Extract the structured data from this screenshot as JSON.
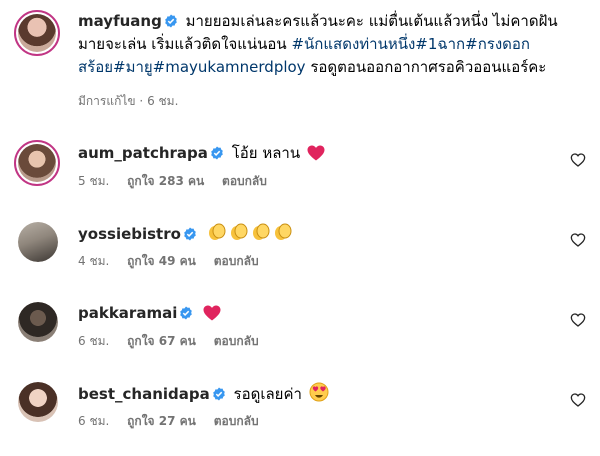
{
  "caption": {
    "username": "mayfuang",
    "text": "มายยอมเล่นละครแล้วนะคะ แม่ตื่นเต้นแล้วหนึ่ง ไม่คาดฝันมายจะเล่น เริ่มแล้วติดใจแน่นอน",
    "hashtags": "#นักแสดงท่านหนึ่ง#1ฉาก#กรงดอกสร้อย#มายู#mayukamnerdploy",
    "text_after": "รอดูตอนออกอากาศรอคิวออนแอร์คะ",
    "edited": "มีการแก้ไข",
    "time": "6 ชม."
  },
  "comments": [
    {
      "username": "aum_patchrapa",
      "text": "โอ้ย หลาน",
      "emoji": "red-heart",
      "time": "5 ชม.",
      "likes": "ถูกใจ 283 คน",
      "reply": "ตอบกลับ"
    },
    {
      "username": "yossiebistro",
      "text": "",
      "emoji": "clapping-hands-x4",
      "time": "4 ชม.",
      "likes": "ถูกใจ 49 คน",
      "reply": "ตอบกลับ"
    },
    {
      "username": "pakkaramai",
      "text": "",
      "emoji": "red-heart",
      "time": "6 ชม.",
      "likes": "ถูกใจ 67 คน",
      "reply": "ตอบกลับ"
    },
    {
      "username": "best_chanidapa",
      "text": "รอดูเลยค่า",
      "emoji": "heart-eyes",
      "time": "6 ชม.",
      "likes": "ถูกใจ 27 คน",
      "reply": "ตอบกลับ"
    }
  ],
  "colors": {
    "verified": "#3897f0",
    "hashtag": "#00376b",
    "meta": "#737373",
    "story_ring": "#c13584"
  }
}
